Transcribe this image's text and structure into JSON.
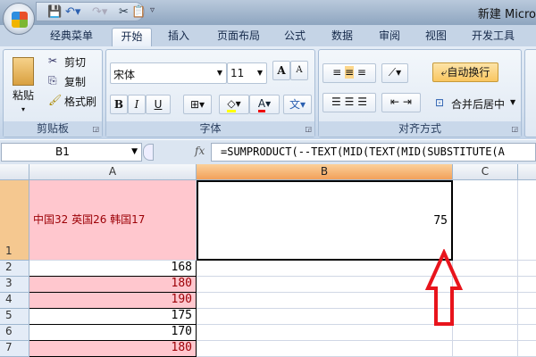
{
  "window": {
    "title": "新建 Micro"
  },
  "tabs": [
    "经典菜单",
    "开始",
    "插入",
    "页面布局",
    "公式",
    "数据",
    "审阅",
    "视图",
    "开发工具"
  ],
  "ribbon": {
    "clipboard": {
      "label": "剪贴板",
      "paste": "粘贴",
      "cut": "剪切",
      "copy": "复制",
      "format_painter": "格式刷"
    },
    "font": {
      "label": "字体",
      "font_name": "宋体",
      "font_size": "11",
      "bold": "B",
      "italic": "I",
      "underline": "U",
      "font_color": "A",
      "grow": "A",
      "shrink": "A",
      "phonetic": "文"
    },
    "alignment": {
      "label": "对齐方式",
      "wrap_text": "自动换行",
      "merge_center": "合并后居中"
    }
  },
  "formula_bar": {
    "name_box": "B1",
    "fx": "fx",
    "formula": "=SUMPRODUCT(--TEXT(MID(TEXT(MID(SUBSTITUTE(A"
  },
  "sheet": {
    "columns": [
      "A",
      "B",
      "C"
    ],
    "rows": [
      {
        "num": "1",
        "a": "中国32 英国26 韩国17",
        "b": "75",
        "pink": true
      },
      {
        "num": "2",
        "a": "168",
        "pink": false
      },
      {
        "num": "3",
        "a": "180",
        "pink": true
      },
      {
        "num": "4",
        "a": "190",
        "pink": true
      },
      {
        "num": "5",
        "a": "175",
        "pink": false
      },
      {
        "num": "6",
        "a": "170",
        "pink": false
      },
      {
        "num": "7",
        "a": "180",
        "pink": true
      }
    ]
  },
  "colors": {
    "highlight_fill": "#ffc7ce",
    "highlight_text": "#9c0006",
    "arrow": "#e8141c"
  }
}
